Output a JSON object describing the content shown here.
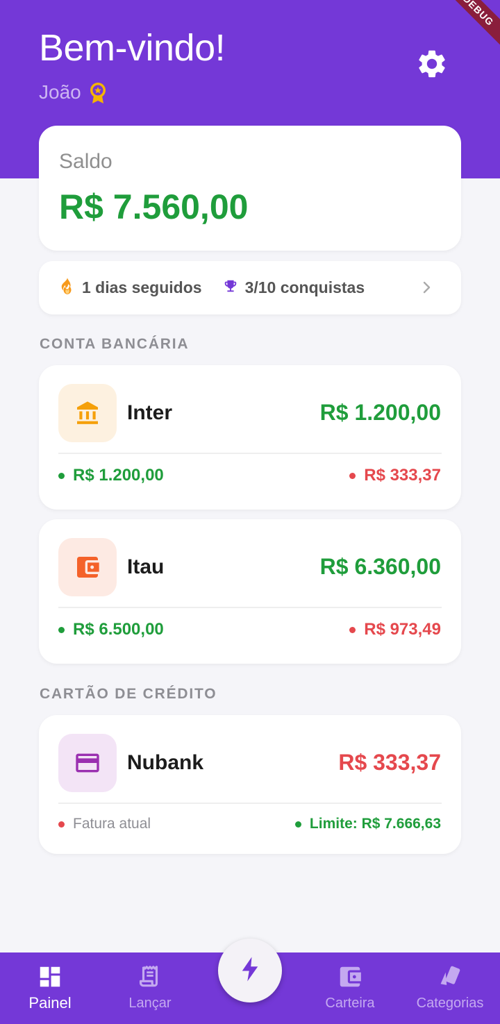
{
  "header": {
    "title": "Bem-vindo!",
    "username": "João",
    "debug_banner": "DEBUG"
  },
  "balance": {
    "label": "Saldo",
    "amount": "R$ 7.560,00"
  },
  "streak": {
    "days": "1 dias seguidos",
    "achievements": "3/10 conquistas"
  },
  "sections": {
    "bank": "CONTA BANCÁRIA",
    "credit": "CARTÃO DE CRÉDITO"
  },
  "accounts": [
    {
      "name": "Inter",
      "balance": "R$ 1.200,00",
      "income": "R$ 1.200,00",
      "expense": "R$ 333,37",
      "icon": "bank-icon",
      "icon_color": "#f5a00a",
      "icon_bg": "#fdf1e0"
    },
    {
      "name": "Itau",
      "balance": "R$ 6.360,00",
      "income": "R$ 6.500,00",
      "expense": "R$ 973,49",
      "icon": "wallet-icon",
      "icon_color": "#f4622a",
      "icon_bg": "#fdeae3"
    }
  ],
  "credit_cards": [
    {
      "name": "Nubank",
      "amount": "R$ 333,37",
      "invoice_label": "Fatura atual",
      "limit": "Limite: R$ 7.666,63",
      "icon": "credit-card-icon",
      "icon_color": "#9a2fb0",
      "icon_bg": "#f3e4f6"
    }
  ],
  "nav": {
    "items": [
      {
        "label": "Painel",
        "icon": "dashboard-icon",
        "active": true
      },
      {
        "label": "Lançar",
        "icon": "receipt-icon",
        "active": false
      },
      {
        "label": "Carteira",
        "icon": "wallet-icon",
        "active": false
      },
      {
        "label": "Categorias",
        "icon": "categories-icon",
        "active": false
      }
    ],
    "fab_icon": "bolt-icon"
  },
  "colors": {
    "primary": "#7438d7",
    "positive": "#1f9d3b",
    "negative": "#e5484d",
    "background": "#f5f5f9"
  }
}
